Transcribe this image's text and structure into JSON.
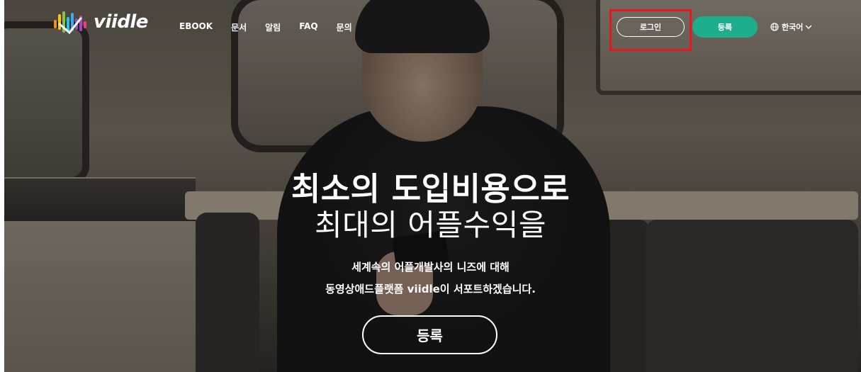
{
  "brand": {
    "name": "viidle"
  },
  "nav": {
    "items": [
      {
        "label": "EBOOK"
      },
      {
        "label": "문서"
      },
      {
        "label": "알림"
      },
      {
        "label": "FAQ"
      },
      {
        "label": "문의"
      }
    ]
  },
  "header": {
    "login_label": "로그인",
    "register_label": "등록",
    "language_label": "한국어",
    "register_color": "#1eae8e",
    "highlight_color": "#e8161d"
  },
  "hero": {
    "headline_line1": "최소의 도입비용으로",
    "headline_line2": "최대의 어플수익을",
    "sub_line1": "세계속의 어플개발사의 니즈에 대해",
    "sub_line2": "동영상애드플랫폼 viidle이 서포트하겠습니다.",
    "cta_label": "등록"
  },
  "icons": [
    "logo-icon",
    "globe-icon",
    "caret-down-icon"
  ]
}
